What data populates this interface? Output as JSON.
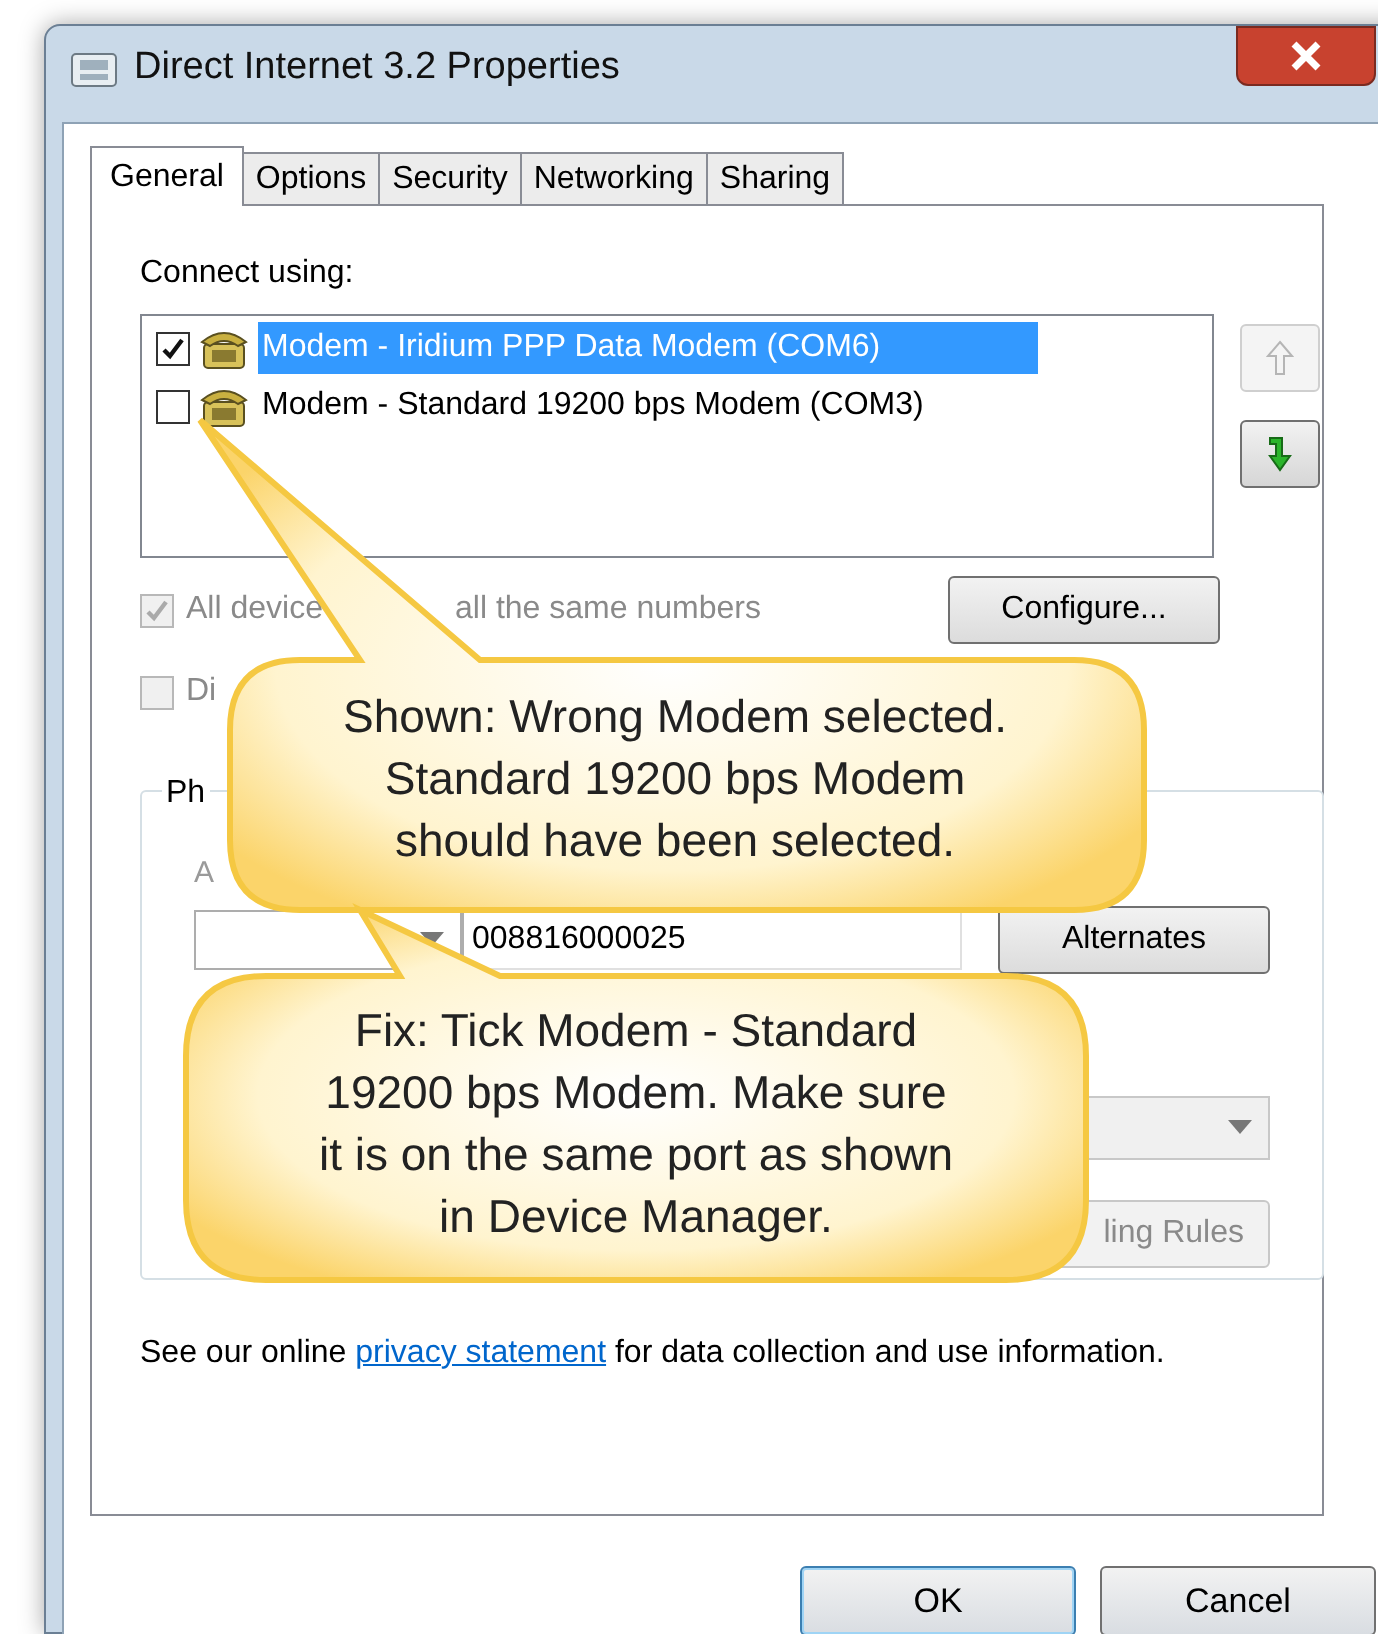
{
  "window": {
    "title": "Direct Internet 3.2 Properties"
  },
  "tabs": [
    {
      "label": "General",
      "selected": true
    },
    {
      "label": "Options",
      "selected": false
    },
    {
      "label": "Security",
      "selected": false
    },
    {
      "label": "Networking",
      "selected": false
    },
    {
      "label": "Sharing",
      "selected": false
    }
  ],
  "connect_using": {
    "label": "Connect using:",
    "devices": [
      {
        "name": "Modem - Iridium PPP Data Modem (COM6)",
        "checked": true,
        "selected": true
      },
      {
        "name": "Modem - Standard 19200 bps Modem (COM3)",
        "checked": false,
        "selected": false
      }
    ],
    "move_buttons": [
      {
        "kind": "up",
        "disabled": true
      },
      {
        "kind": "down",
        "disabled": false
      }
    ]
  },
  "options": [
    {
      "label_parts": [
        "All device",
        "all the same numbers"
      ],
      "checked": true
    },
    {
      "label_parts": [
        "Di"
      ],
      "checked": false
    }
  ],
  "configure_button": "Configure...",
  "phone_group": {
    "label": "Ph",
    "area_code_label": "A",
    "phone_number": "008816000025",
    "alternates_button": "Alternates",
    "dialing_rules_button": "ling Rules"
  },
  "privacy": {
    "before": "See our online ",
    "link": "privacy statement",
    "after": " for data collection and use information."
  },
  "buttons": [
    {
      "label": "OK",
      "default": true
    },
    {
      "label": "Cancel",
      "default": false
    }
  ],
  "callouts": [
    {
      "lines": [
        "Shown: Wrong Modem selected.",
        "Standard 19200 bps Modem",
        "should have been selected."
      ]
    },
    {
      "lines": [
        "Fix: Tick Modem - Standard",
        "19200 bps Modem.  Make sure",
        "it is on the same port as shown",
        "in Device Manager."
      ]
    }
  ]
}
